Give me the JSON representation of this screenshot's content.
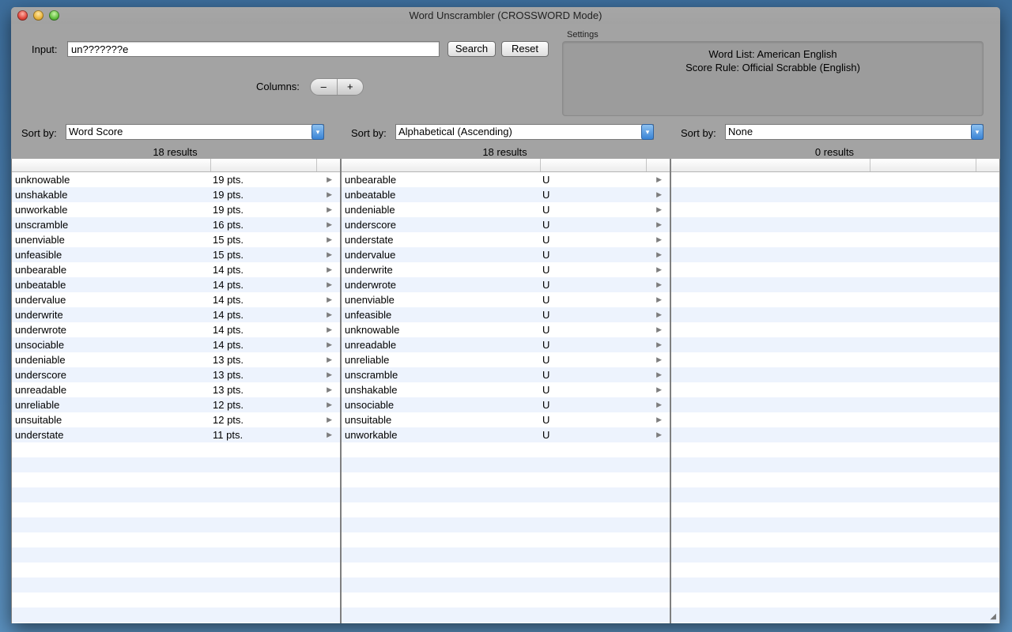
{
  "window": {
    "title": "Word Unscrambler (CROSSWORD Mode)"
  },
  "input": {
    "label": "Input:",
    "value": "un???????e"
  },
  "buttons": {
    "search": "Search",
    "reset": "Reset"
  },
  "columns": {
    "label": "Columns:",
    "minus": "–",
    "plus": "+"
  },
  "settings": {
    "legend": "Settings",
    "word_list": "Word List: American English",
    "score_rule": "Score Rule: Official Scrabble (English)"
  },
  "panes": [
    {
      "sort_label": "Sort by:",
      "sort_value": "Word Score",
      "results": "18 results",
      "rows": [
        {
          "word": "unknowable",
          "info": "19 pts."
        },
        {
          "word": "unshakable",
          "info": "19 pts."
        },
        {
          "word": "unworkable",
          "info": "19 pts."
        },
        {
          "word": "unscramble",
          "info": "16 pts."
        },
        {
          "word": "unenviable",
          "info": "15 pts."
        },
        {
          "word": "unfeasible",
          "info": "15 pts."
        },
        {
          "word": "unbearable",
          "info": "14 pts."
        },
        {
          "word": "unbeatable",
          "info": "14 pts."
        },
        {
          "word": "undervalue",
          "info": "14 pts."
        },
        {
          "word": "underwrite",
          "info": "14 pts."
        },
        {
          "word": "underwrote",
          "info": "14 pts."
        },
        {
          "word": "unsociable",
          "info": "14 pts."
        },
        {
          "word": "undeniable",
          "info": "13 pts."
        },
        {
          "word": "underscore",
          "info": "13 pts."
        },
        {
          "word": "unreadable",
          "info": "13 pts."
        },
        {
          "word": "unreliable",
          "info": "12 pts."
        },
        {
          "word": "unsuitable",
          "info": "12 pts."
        },
        {
          "word": "understate",
          "info": "11 pts."
        }
      ]
    },
    {
      "sort_label": "Sort by:",
      "sort_value": "Alphabetical (Ascending)",
      "results": "18 results",
      "rows": [
        {
          "word": "unbearable",
          "info": "U"
        },
        {
          "word": "unbeatable",
          "info": "U"
        },
        {
          "word": "undeniable",
          "info": "U"
        },
        {
          "word": "underscore",
          "info": "U"
        },
        {
          "word": "understate",
          "info": "U"
        },
        {
          "word": "undervalue",
          "info": "U"
        },
        {
          "word": "underwrite",
          "info": "U"
        },
        {
          "word": "underwrote",
          "info": "U"
        },
        {
          "word": "unenviable",
          "info": "U"
        },
        {
          "word": "unfeasible",
          "info": "U"
        },
        {
          "word": "unknowable",
          "info": "U"
        },
        {
          "word": "unreadable",
          "info": "U"
        },
        {
          "word": "unreliable",
          "info": "U"
        },
        {
          "word": "unscramble",
          "info": "U"
        },
        {
          "word": "unshakable",
          "info": "U"
        },
        {
          "word": "unsociable",
          "info": "U"
        },
        {
          "word": "unsuitable",
          "info": "U"
        },
        {
          "word": "unworkable",
          "info": "U"
        }
      ]
    },
    {
      "sort_label": "Sort by:",
      "sort_value": "None",
      "results": "0 results",
      "rows": []
    }
  ],
  "icons": {
    "row_arrow": "disclosure-triangle-icon",
    "select_arrow": "select-arrow-icon",
    "resize": "resize-grip-icon"
  }
}
